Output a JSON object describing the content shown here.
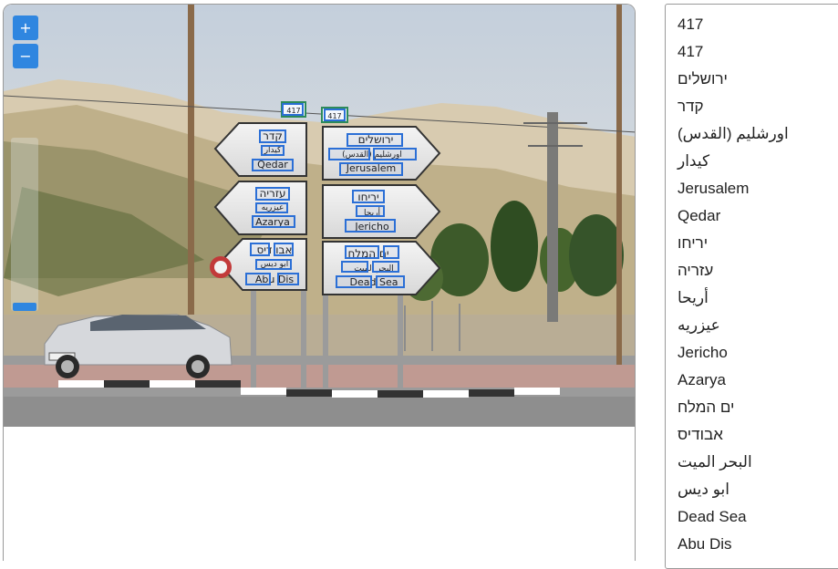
{
  "viewer": {
    "zoom_in_label": "+",
    "zoom_out_label": "−",
    "zoom_level": 0.0,
    "accent_color": "#2f86e0",
    "box_color": "#2b6fd6"
  },
  "photo": {
    "sign_texts": {
      "s1": [
        "קדר",
        "كيدار",
        "Qedar"
      ],
      "s2": [
        "עזריה",
        "عيزريه",
        "Azarya"
      ],
      "s3": [
        "אבו דיס",
        "ابو ديس",
        "Abu Dis"
      ],
      "s4": [
        "ירושלים",
        "اورشليم (القدس)",
        "Jerusalem"
      ],
      "s5": [
        "יריחו",
        "أريحا",
        "Jericho"
      ],
      "s6": [
        "ים המלח",
        "البحر الميت",
        "Dead Sea"
      ],
      "route_numbers": [
        "417",
        "417"
      ]
    }
  },
  "list": {
    "items": [
      "417",
      "417",
      "ירושלים",
      "קדר",
      "اورشليم (القدس)",
      "كيدار",
      "Jerusalem",
      "Qedar",
      "יריחו",
      "עזריה",
      "أريحا",
      "عيزريه",
      "Jericho",
      "Azarya",
      "ים המלח",
      "אבודיס",
      "البحر الميت",
      "ابو ديس",
      "Dead Sea",
      "Abu Dis"
    ]
  }
}
